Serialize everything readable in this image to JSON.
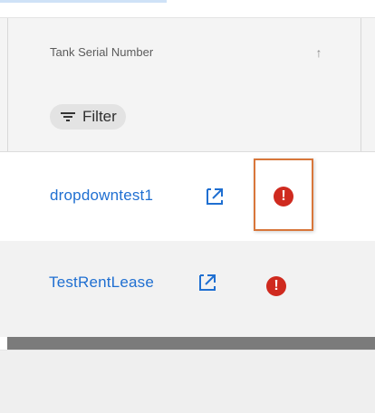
{
  "table": {
    "column_header": "Tank Serial Number",
    "filter_label": "Filter",
    "rows": [
      {
        "tank_serial": "dropdowntest1",
        "status": "alert"
      },
      {
        "tank_serial": "TestRentLease",
        "status": "alert"
      }
    ]
  },
  "icons": {
    "sort": "sort-ascending-icon",
    "filter": "filter-icon",
    "external_link": "external-link-icon",
    "alert": "alert-exclamation-icon"
  },
  "colors": {
    "link": "#1f6fd1",
    "alert": "#cf2a1f",
    "highlight": "#d8763a"
  },
  "alert_glyph": "!",
  "sort_glyph": "↑"
}
